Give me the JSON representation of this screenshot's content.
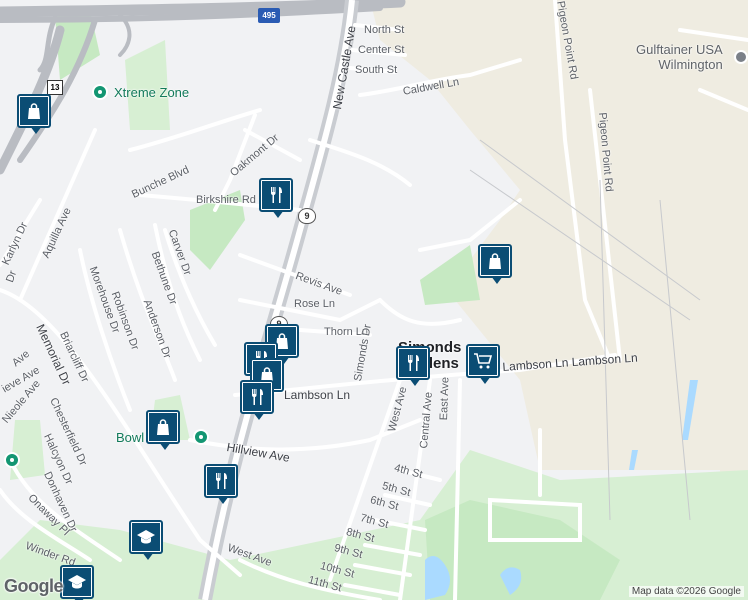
{
  "map": {
    "colors": {
      "background": "#f1f2f4",
      "industrial": "#efece1",
      "park": "#cdeccc",
      "road": "#ffffff",
      "highway": "#b9bcc2",
      "pin": "#0b4d74",
      "poi_green": "#139672"
    },
    "streets": {
      "north_st": "North St",
      "center_st": "Center St",
      "south_st": "South St",
      "caldwell_ln": "Caldwell Ln",
      "new_castle_ave": "New Castle Ave",
      "pigeon_point_rd_top": "Pigeon Point Rd",
      "pigeon_point_rd_mid": "Pigeon Point Rd",
      "oakmont_dr": "Oakmont Dr",
      "bunche_blvd": "Bunche Blvd",
      "birkshire_rd": "Birkshire Rd",
      "aquilla_ave": "Aquilla Ave",
      "karlyn_dr": "Karlyn Dr",
      "carver_dr": "Carver Dr",
      "bethune_dr": "Bethune Dr",
      "morehouse_dr": "Morehouse Dr",
      "robinson_dr": "Robinson Dr",
      "anderson_dr": "Anderson Dr",
      "revis_ave": "Revis Ave",
      "rose_ln": "Rose Ln",
      "thorn_ln": "Thorn Ln",
      "simonds_dr": "Simonds Dr",
      "lambson_ln_left": "Lambson Ln",
      "lambson_ln_right": "Lambson Ln Lambson Ln",
      "memorial_dr": "Memorial Dr",
      "briarcliff_dr": "Briarcliff Dr",
      "nieole_ave": "Nieole Ave",
      "chesterfield_dr": "Chesterfield Dr",
      "halcyon_dr": "Halcyon Dr",
      "donhaven_dr": "Donhaven Dr",
      "onaway_pl": "Onaway Pl",
      "winder_rd": "Winder Rd",
      "hillview_ave": "Hillview Ave",
      "west_ave_top": "West Ave",
      "west_ave_bottom": "West Ave",
      "central_ave": "Central Ave",
      "east_ave": "East Ave",
      "4th_st": "4th St",
      "5th_st": "5th St",
      "6th_st": "6th St",
      "7th_st": "7th St",
      "8th_st": "8th St",
      "9th_st": "9th St",
      "10th_st": "10th St",
      "11th_st": "11th St",
      "ave_fragment": "Ave",
      "eve_ave_fragment": "ieve Ave",
      "dr_fragment": "Dr"
    },
    "places": {
      "simonds_line1": "Simonds",
      "simonds_line2": "Gardens",
      "xtreme_zone": "Xtreme Zone",
      "gulftainer_line1": "Gulftainer USA",
      "gulftainer_line2": "Wilmington",
      "bowl_fragment": "Bowl"
    },
    "shields": {
      "i495": "495",
      "us13": "13",
      "de9_a": "9",
      "de9_b": "9"
    },
    "pins": [
      {
        "name": "shopping-pin-1",
        "icon": "shopping-bag-icon"
      },
      {
        "name": "restaurant-pin-1",
        "icon": "fork-knife-icon"
      },
      {
        "name": "shopping-pin-2",
        "icon": "shopping-bag-icon"
      },
      {
        "name": "shopping-pin-3",
        "icon": "shopping-bag-icon"
      },
      {
        "name": "restaurant-pin-2",
        "icon": "fork-knife-icon"
      },
      {
        "name": "shopping-pin-4",
        "icon": "shopping-bag-icon"
      },
      {
        "name": "restaurant-pin-3",
        "icon": "fork-knife-icon"
      },
      {
        "name": "restaurant-pin-4",
        "icon": "fork-knife-icon"
      },
      {
        "name": "cart-pin",
        "icon": "shopping-cart-icon"
      },
      {
        "name": "shopping-pin-5",
        "icon": "shopping-bag-icon"
      },
      {
        "name": "restaurant-pin-5",
        "icon": "fork-knife-icon"
      },
      {
        "name": "school-pin-1",
        "icon": "graduation-cap-icon"
      },
      {
        "name": "school-pin-2",
        "icon": "graduation-cap-icon"
      }
    ],
    "branding": {
      "logo": "Google",
      "attribution": "Map data ©2026 Google"
    }
  }
}
